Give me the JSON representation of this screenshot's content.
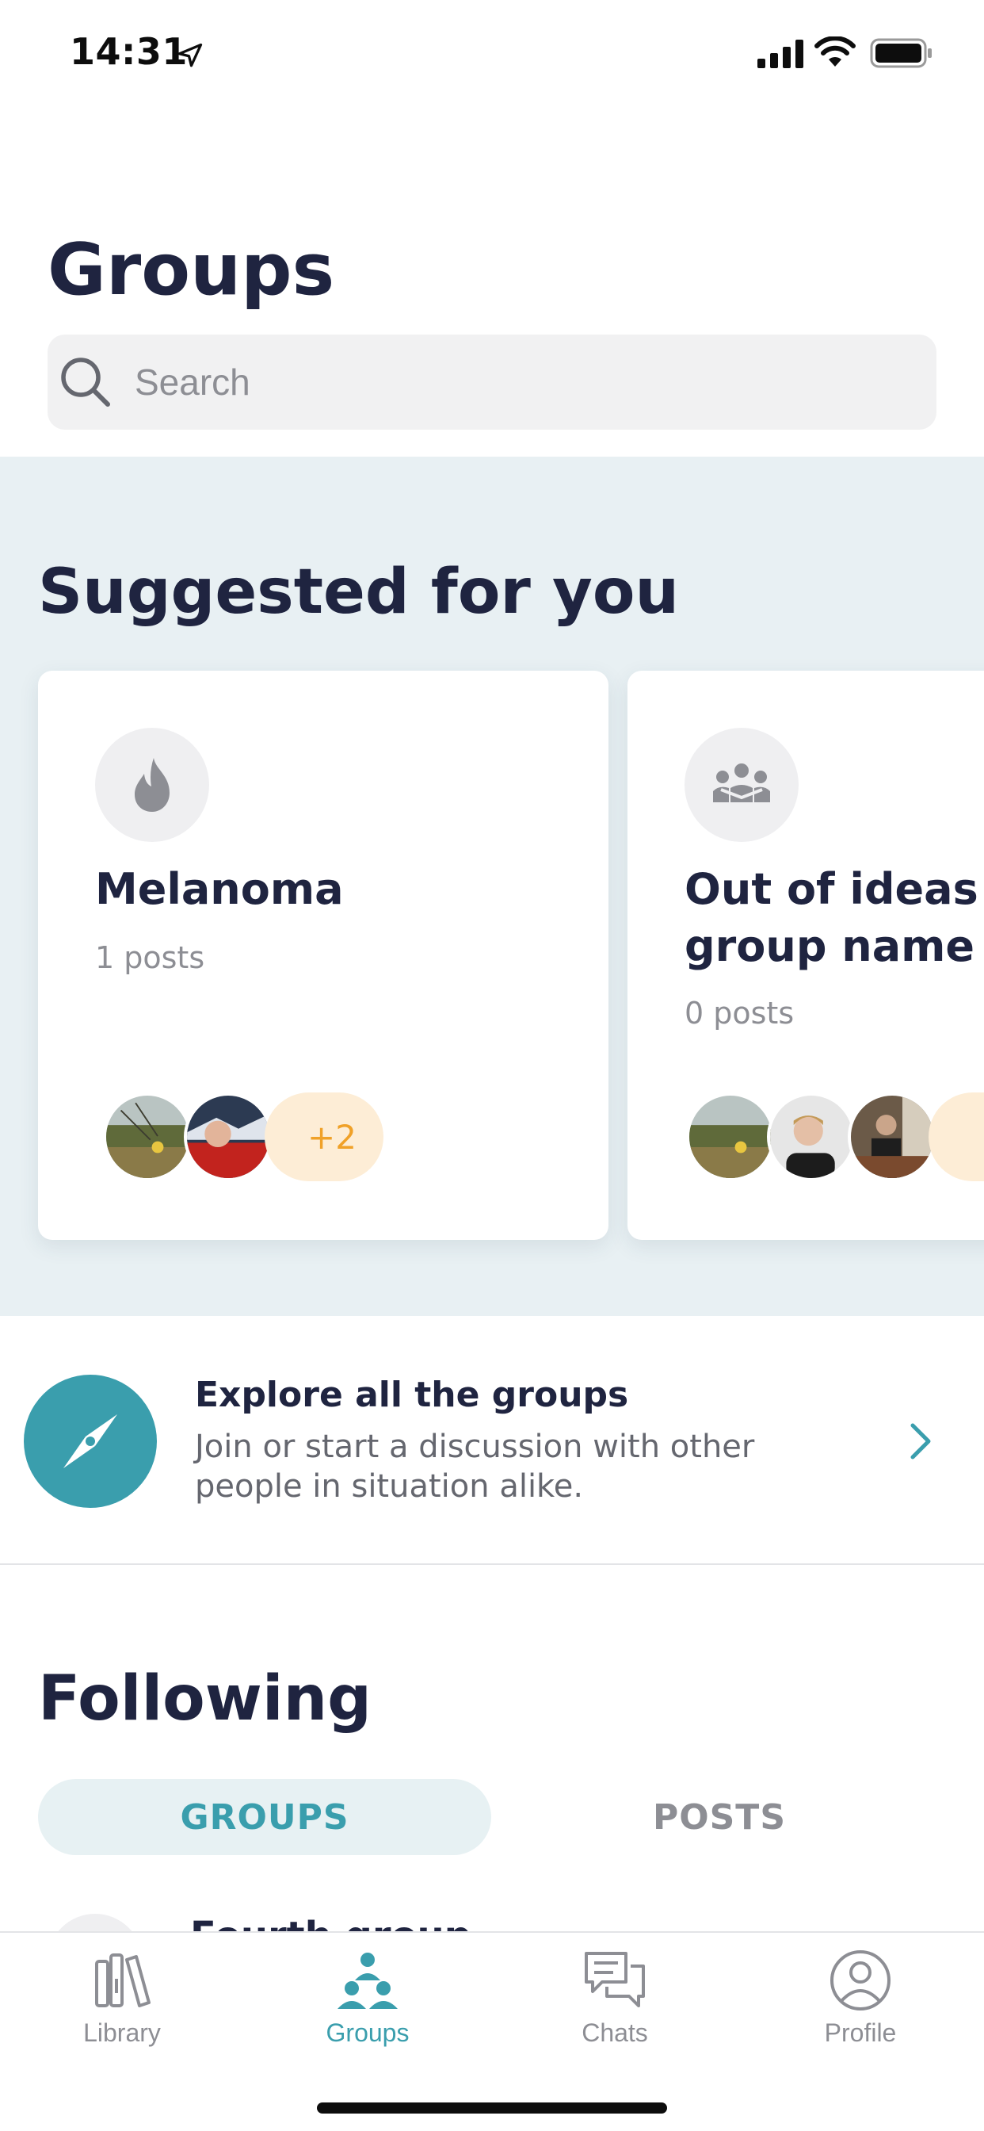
{
  "status_bar": {
    "time": "14:31"
  },
  "header": {
    "title": "Groups"
  },
  "search": {
    "placeholder": "Search"
  },
  "suggested": {
    "title": "Suggested for you",
    "cards": [
      {
        "title": "Melanoma",
        "count": "1 posts",
        "icon": "flame-icon",
        "more": "+2"
      },
      {
        "title_line1": "Out of ideas f",
        "title_line2": "group name",
        "count": "0 posts",
        "icon": "group-people-icon",
        "more": "+"
      }
    ]
  },
  "explore": {
    "title": "Explore all the groups",
    "description": "Join or start a discussion with other people in situation alike.",
    "icon": "compass-icon"
  },
  "following": {
    "title": "Following",
    "tabs": [
      {
        "label": "GROUPS",
        "active": true
      },
      {
        "label": "POSTS",
        "active": false
      }
    ],
    "first_item_title": "Fourth group"
  },
  "tab_bar": {
    "items": [
      {
        "label": "Library",
        "icon": "library-icon",
        "active": false
      },
      {
        "label": "Groups",
        "icon": "groups-icon",
        "active": true
      },
      {
        "label": "Chats",
        "icon": "chats-icon",
        "active": false
      },
      {
        "label": "Profile",
        "icon": "profile-icon",
        "active": false
      }
    ]
  },
  "colors": {
    "accent": "#3a9ead",
    "title": "#1f2440",
    "section_bg": "#e8f0f3",
    "badge_bg": "#fdedd6",
    "badge_text": "#f0a128",
    "muted": "#8d8e94"
  }
}
